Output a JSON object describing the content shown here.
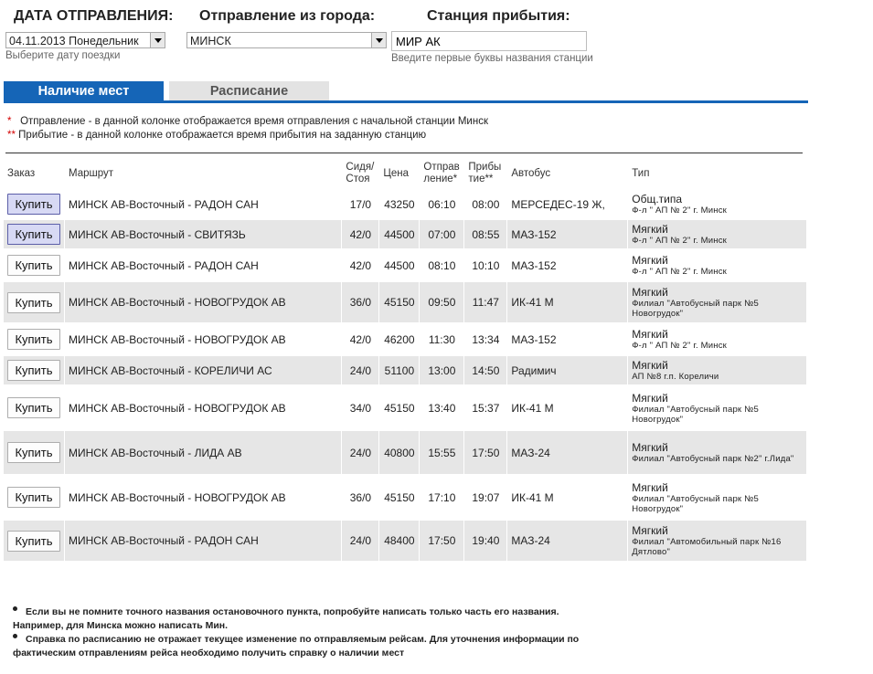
{
  "form": {
    "date_label": "ДАТА ОТПРАВЛЕНИЯ:",
    "date_value": "04.11.2013 Понедельник",
    "date_hint": "Выберите дату поездки",
    "from_label": "Отправление из города:",
    "from_value": "МИНСК",
    "to_label": "Станция прибытия:",
    "to_value": "МИР АК",
    "to_hint": "Введите первые буквы названия станции"
  },
  "tabs": {
    "availability": "Наличие мест",
    "schedule": "Расписание"
  },
  "notes": {
    "dep_star": "*",
    "dep_text": "Отправление - в данной колонке отображается время отправления с начальной станции Минск",
    "arr_star": "**",
    "arr_text": "Прибытие - в данной колонке отображается время прибытия на заданную станцию"
  },
  "table": {
    "headers": {
      "order": "Заказ",
      "route": "Маршрут",
      "seats_1": "Сидя/",
      "seats_2": "Стоя",
      "price": "Цена",
      "dep_1": "Отправ",
      "dep_2": "ление*",
      "arr_1": "Прибы",
      "arr_2": "тие**",
      "bus": "Автобус",
      "type": "Тип"
    },
    "buy_label": "Купить",
    "rows": [
      {
        "route": "МИНСК АВ-Восточный - РАДОН САН",
        "seats": "17/0",
        "price": "43250",
        "dep": "06:10",
        "arr": "08:00",
        "bus": "МЕРСЕДЕС-19 Ж,",
        "type": "Общ.типа",
        "carrier": "Ф-л \" АП № 2\" г. Минск"
      },
      {
        "route": "МИНСК АВ-Восточный - СВИТЯЗЬ",
        "seats": "42/0",
        "price": "44500",
        "dep": "07:00",
        "arr": "08:55",
        "bus": "МАЗ-152",
        "type": "Мягкий",
        "carrier": "Ф-л \" АП № 2\" г. Минск"
      },
      {
        "route": "МИНСК АВ-Восточный - РАДОН САН",
        "seats": "42/0",
        "price": "44500",
        "dep": "08:10",
        "arr": "10:10",
        "bus": "МАЗ-152",
        "type": "Мягкий",
        "carrier": "Ф-л \" АП № 2\" г. Минск"
      },
      {
        "route": "МИНСК АВ-Восточный - НОВОГРУДОК АВ",
        "seats": "36/0",
        "price": "45150",
        "dep": "09:50",
        "arr": "11:47",
        "bus": "ИК-41 М",
        "type": "Мягкий",
        "carrier": "Филиал \"Автобусный парк №5 Новогрудок\""
      },
      {
        "route": "МИНСК АВ-Восточный - НОВОГРУДОК АВ",
        "seats": "42/0",
        "price": "46200",
        "dep": "11:30",
        "arr": "13:34",
        "bus": "МАЗ-152",
        "type": "Мягкий",
        "carrier": "Ф-л \" АП № 2\" г. Минск"
      },
      {
        "route": "МИНСК АВ-Восточный - КОРЕЛИЧИ АС",
        "seats": "24/0",
        "price": "51100",
        "dep": "13:00",
        "arr": "14:50",
        "bus": "Радимич",
        "type": "Мягкий",
        "carrier": "АП №8 г.п. Кореличи"
      },
      {
        "route": "МИНСК АВ-Восточный - НОВОГРУДОК АВ",
        "seats": "34/0",
        "price": "45150",
        "dep": "13:40",
        "arr": "15:37",
        "bus": "ИК-41 М",
        "type": "Мягкий",
        "carrier": "Филиал \"Автобусный парк №5 Новогрудок\""
      },
      {
        "route": "МИНСК АВ-Восточный - ЛИДА АВ",
        "seats": "24/0",
        "price": "40800",
        "dep": "15:55",
        "arr": "17:50",
        "bus": "МАЗ-24",
        "type": "Мягкий",
        "carrier": "Филиал \"Автобусный парк №2\" г.Лида\""
      },
      {
        "route": "МИНСК АВ-Восточный - НОВОГРУДОК АВ",
        "seats": "36/0",
        "price": "45150",
        "dep": "17:10",
        "arr": "19:07",
        "bus": "ИК-41 М",
        "type": "Мягкий",
        "carrier": "Филиал \"Автобусный парк №5 Новогрудок\""
      },
      {
        "route": "МИНСК АВ-Восточный - РАДОН САН",
        "seats": "24/0",
        "price": "48400",
        "dep": "17:50",
        "arr": "19:40",
        "bus": "МАЗ-24",
        "type": "Мягкий",
        "carrier": "Филиал \"Автомобильный парк №16 Дятлово\""
      }
    ]
  },
  "footnotes": {
    "tip1_line1": "Если вы не помните точного названия остановочного пункта, попробуйте написать только часть его названия.",
    "tip1_line2": "Например, для Минска можно написать Мин.",
    "tip2_line1": "Справка по расписанию не отражает текущее изменение по отправляемым рейсам. Для уточнения информации по",
    "tip2_line2": "фактическим отправлениям рейса необходимо получить справку о наличии мест"
  },
  "colors": {
    "tab_active": "#1565b7",
    "row_shaded": "#e6e6e6",
    "star_red": "#d40000"
  }
}
